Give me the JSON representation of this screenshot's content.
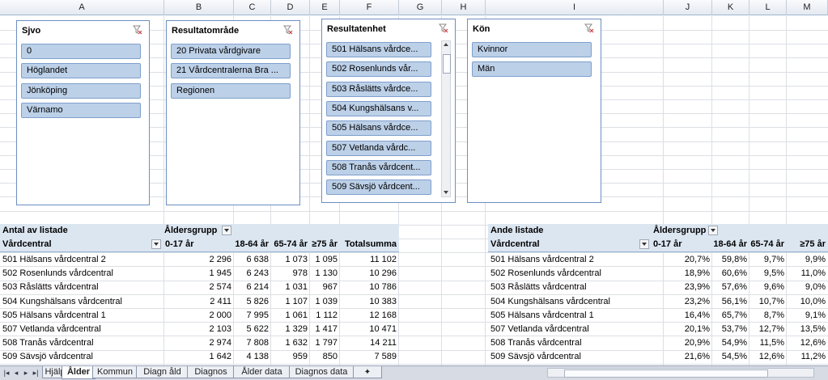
{
  "columns": [
    "A",
    "B",
    "C",
    "D",
    "E",
    "F",
    "G",
    "H",
    "I",
    "J",
    "K",
    "L",
    "M"
  ],
  "slicers": [
    {
      "title": "Sjvo",
      "items": [
        "0",
        "Höglandet",
        "Jönköping",
        "Värnamo"
      ]
    },
    {
      "title": "Resultatområde",
      "items": [
        "20 Privata vårdgivare",
        "21 Vårdcentralerna Bra ...",
        "Regionen"
      ]
    },
    {
      "title": "Resultatenhet",
      "items": [
        "501 Hälsans vårdce...",
        "502 Rosenlunds vår...",
        "503 Råslätts vårdce...",
        "504 Kungshälsans v...",
        "505 Hälsans vårdce...",
        "507 Vetlanda vårdc...",
        "508 Tranås vårdcent...",
        "509 Sävsjö vårdcent..."
      ]
    },
    {
      "title": "Kön",
      "items": [
        "Kvinnor",
        "Män"
      ]
    }
  ],
  "pivot1": {
    "title": "Antal av listade",
    "col_field": "Åldersgrupp",
    "row_field": "Vårdcentral",
    "headers": [
      "0-17 år",
      "18-64 år",
      "65-74 år",
      "≥75 år",
      "Totalsumma"
    ],
    "rows": [
      {
        "name": "501 Hälsans vårdcentral 2",
        "v": [
          "2 296",
          "6 638",
          "1 073",
          "1 095",
          "11 102"
        ]
      },
      {
        "name": "502 Rosenlunds vårdcentral",
        "v": [
          "1 945",
          "6 243",
          "978",
          "1 130",
          "10 296"
        ]
      },
      {
        "name": "503 Råslätts vårdcentral",
        "v": [
          "2 574",
          "6 214",
          "1 031",
          "967",
          "10 786"
        ]
      },
      {
        "name": "504 Kungshälsans vårdcentral",
        "v": [
          "2 411",
          "5 826",
          "1 107",
          "1 039",
          "10 383"
        ]
      },
      {
        "name": "505 Hälsans vårdcentral 1",
        "v": [
          "2 000",
          "7 995",
          "1 061",
          "1 112",
          "12 168"
        ]
      },
      {
        "name": "507 Vetlanda vårdcentral",
        "v": [
          "2 103",
          "5 622",
          "1 329",
          "1 417",
          "10 471"
        ]
      },
      {
        "name": "508 Tranås vårdcentral",
        "v": [
          "2 974",
          "7 808",
          "1 632",
          "1 797",
          "14 211"
        ]
      },
      {
        "name": "509 Sävsjö vårdcentral",
        "v": [
          "1 642",
          "4 138",
          "959",
          "850",
          "7 589"
        ]
      }
    ]
  },
  "pivot2": {
    "title": "Ande listade",
    "col_field": "Åldersgrupp",
    "row_field": "Vårdcentral",
    "headers": [
      "0-17 år",
      "18-64 år",
      "65-74 år",
      "≥75 år"
    ],
    "rows": [
      {
        "name": "501 Hälsans vårdcentral 2",
        "v": [
          "20,7%",
          "59,8%",
          "9,7%",
          "9,9%"
        ]
      },
      {
        "name": "502 Rosenlunds vårdcentral",
        "v": [
          "18,9%",
          "60,6%",
          "9,5%",
          "11,0%"
        ]
      },
      {
        "name": "503 Råslätts vårdcentral",
        "v": [
          "23,9%",
          "57,6%",
          "9,6%",
          "9,0%"
        ]
      },
      {
        "name": "504 Kungshälsans vårdcentral",
        "v": [
          "23,2%",
          "56,1%",
          "10,7%",
          "10,0%"
        ]
      },
      {
        "name": "505 Hälsans vårdcentral 1",
        "v": [
          "16,4%",
          "65,7%",
          "8,7%",
          "9,1%"
        ]
      },
      {
        "name": "507 Vetlanda vårdcentral",
        "v": [
          "20,1%",
          "53,7%",
          "12,7%",
          "13,5%"
        ]
      },
      {
        "name": "508 Tranås vårdcentral",
        "v": [
          "20,9%",
          "54,9%",
          "11,5%",
          "12,6%"
        ]
      },
      {
        "name": "509 Sävsjö vårdcentral",
        "v": [
          "21,6%",
          "54,5%",
          "12,6%",
          "11,2%"
        ]
      }
    ]
  },
  "sheet_tabs": [
    "Hjälp",
    "Ålder",
    "Kommun",
    "Diagn åld",
    "Diagnos",
    "Ålder data",
    "Diagnos data"
  ],
  "active_tab": "Ålder",
  "colors": {
    "slicer_item": "#bcd0e8",
    "pivot_header": "#dce6f1",
    "slicer_border": "#6d8fc2"
  }
}
